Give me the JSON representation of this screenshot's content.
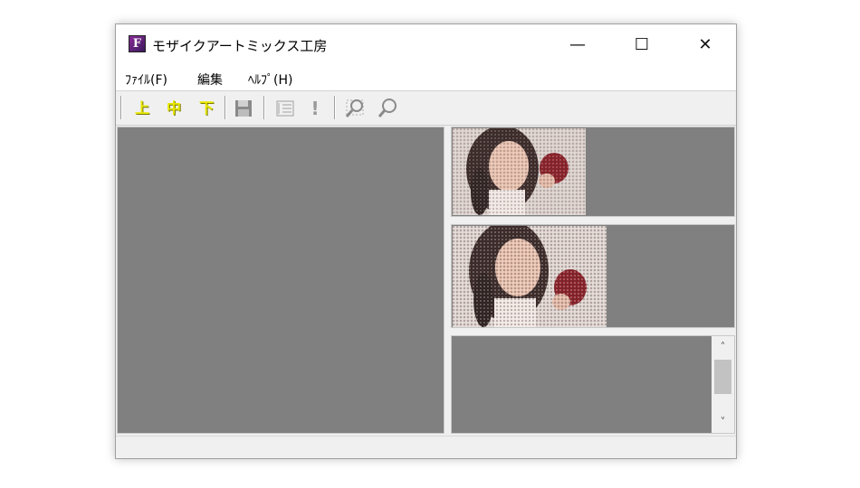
{
  "window": {
    "title": "モザイクアートミックス工房",
    "icon_letter": "F",
    "controls": {
      "minimize": "—",
      "maximize": "☐",
      "close": "✕"
    }
  },
  "menu": [
    {
      "label": "ﾌｧｲﾙ(F)"
    },
    {
      "label": "編集"
    },
    {
      "label": "ﾍﾙﾌﾟ(H)"
    }
  ],
  "toolbar": {
    "top": "上",
    "middle": "中",
    "bottom": "下",
    "save_icon": "floppy-disk-icon",
    "list_icon": "list-icon",
    "run_icon": "exclamation-icon",
    "zoom_in_icon": "zoom-in-icon",
    "zoom_out_icon": "zoom-out-icon"
  },
  "scrollbar": {
    "up": "˄",
    "down": "˅"
  },
  "colors": {
    "panel_bg": "#808080",
    "window_bg": "#f0f0f0",
    "toolbar_yellow": "#e8e800"
  }
}
